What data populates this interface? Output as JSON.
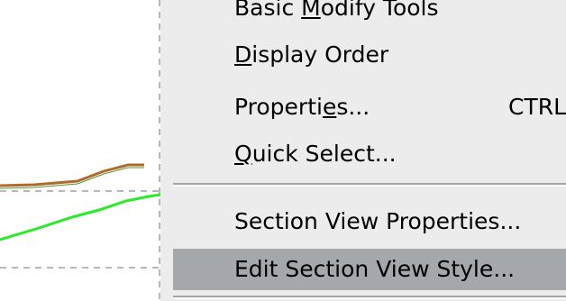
{
  "menu": {
    "items": [
      {
        "label_pre": "Basic ",
        "label_ul": "M",
        "label_post": "odify Tools",
        "shortcut": ""
      },
      {
        "label_pre": "",
        "label_ul": "D",
        "label_post": "isplay Order",
        "shortcut": ""
      },
      {
        "label_pre": "Properti",
        "label_ul": "e",
        "label_post": "s...",
        "shortcut": "CTRL+"
      },
      {
        "label_pre": "",
        "label_ul": "Q",
        "label_post": "uick Select...",
        "shortcut": ""
      },
      {
        "label_pre": "Section View Properties...",
        "label_ul": "",
        "label_post": "",
        "shortcut": ""
      },
      {
        "label_pre": "Edit Section View Style...",
        "label_ul": "",
        "label_post": "",
        "shortcut": ""
      }
    ],
    "highlighted_index": 5
  },
  "colors": {
    "menu_bg": "#ececec",
    "highlight_bg": "#a4a7ab",
    "profile_line_brown": "#b06a2a",
    "profile_line_green": "#2aeb2a",
    "grid_dash": "#b8b8b8"
  }
}
